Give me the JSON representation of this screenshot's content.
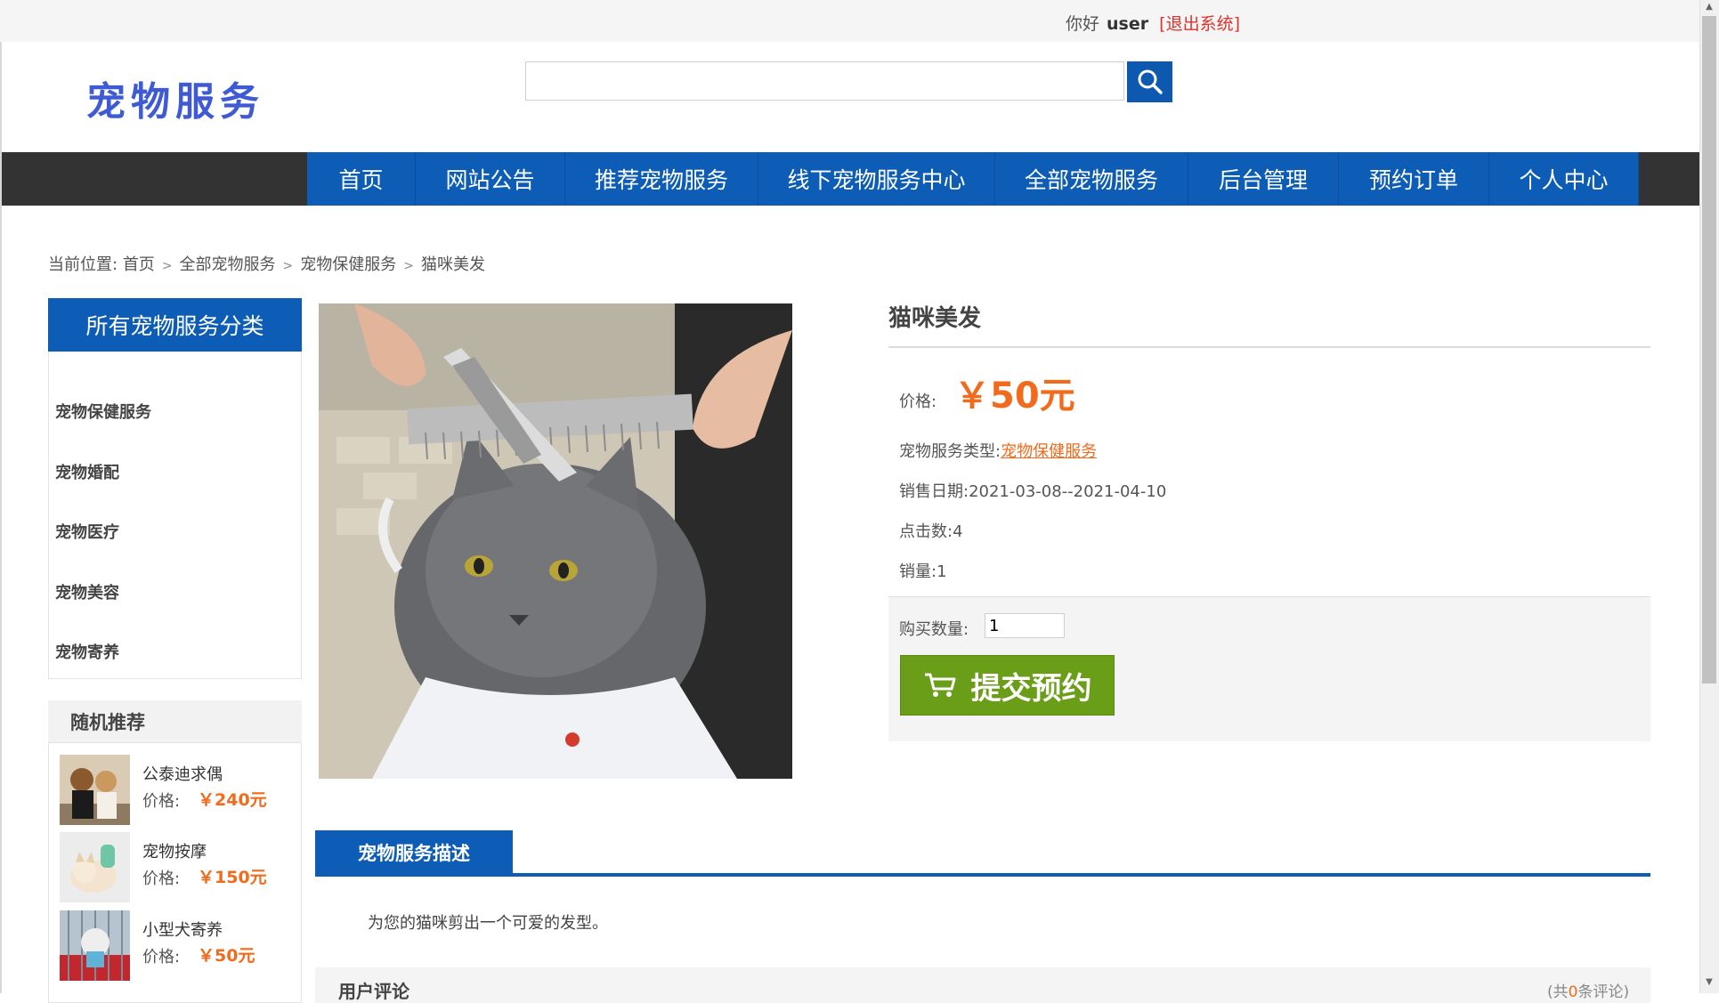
{
  "topbar": {
    "greeting": "你好",
    "username": "user",
    "logout": "[退出系统]"
  },
  "header": {
    "logo": "宠物服务",
    "search_placeholder": "",
    "search_icon": "search-icon"
  },
  "nav": {
    "items": [
      "首页",
      "网站公告",
      "推荐宠物服务",
      "线下宠物服务中心",
      "全部宠物服务",
      "后台管理",
      "预约订单",
      "个人中心"
    ]
  },
  "breadcrumb": {
    "prefix": "当前位置:",
    "items": [
      "首页",
      "全部宠物服务",
      "宠物保健服务",
      "猫咪美发"
    ]
  },
  "sidebar": {
    "title": "所有宠物服务分类",
    "categories": [
      "宠物保健服务",
      "宠物婚配",
      "宠物医疗",
      "宠物美容",
      "宠物寄养"
    ],
    "random_title": "随机推荐",
    "recommendations": [
      {
        "name": "公泰迪求偶",
        "price_label": "价格:",
        "price": "￥240元"
      },
      {
        "name": "宠物按摩",
        "price_label": "价格:",
        "price": "￥150元"
      },
      {
        "name": "小型犬寄养",
        "price_label": "价格:",
        "price": "￥50元"
      }
    ]
  },
  "product": {
    "title": "猫咪美发",
    "price_label": "价格:",
    "price": "￥50元",
    "type_label": "宠物服务类型:",
    "type_value": "宠物保健服务",
    "date_label": "销售日期:",
    "date_value": "2021-03-08--2021-04-10",
    "clicks_label": "点击数:",
    "clicks_value": "4",
    "sales_label": "销量:",
    "sales_value": "1",
    "qty_label": "购买数量:",
    "qty_value": "1",
    "submit_label": "提交预约"
  },
  "description": {
    "tab": "宠物服务描述",
    "text": "为您的猫咪剪出一个可爱的发型。"
  },
  "reviews": {
    "title": "用户评论",
    "count_prefix": "(共",
    "count": "0",
    "count_suffix": "条评论)"
  },
  "colors": {
    "nav_blue": "#0d5cb6",
    "accent_orange": "#f26b1d",
    "submit_green": "#6a9e19",
    "logo_blue": "#3f5bd4"
  }
}
